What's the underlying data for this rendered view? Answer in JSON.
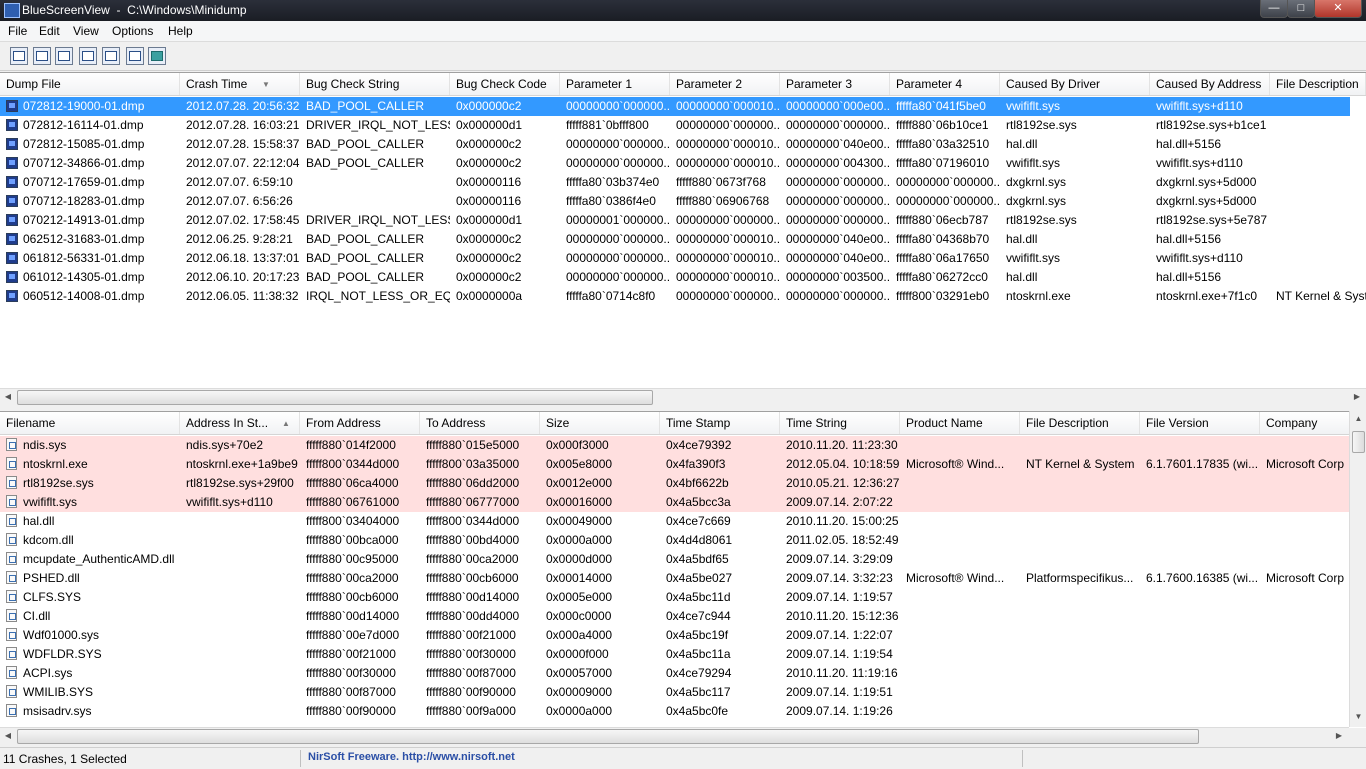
{
  "window": {
    "title": "BlueScreenView  -  C:\\Windows\\Minidump"
  },
  "menu": [
    "File",
    "Edit",
    "View",
    "Options",
    "Help"
  ],
  "toolbar": [
    "save-html-report-icon",
    "save-icon",
    "refresh-icon",
    "copy-icon",
    "properties-icon",
    "find-icon",
    "exit-icon"
  ],
  "crash_list": {
    "columns": [
      "Dump File",
      "Crash Time",
      "Bug Check String",
      "Bug Check Code",
      "Parameter 1",
      "Parameter 2",
      "Parameter 3",
      "Parameter 4",
      "Caused By Driver",
      "Caused By Address",
      "File Description"
    ],
    "rows": [
      [
        "072812-19000-01.dmp",
        "2012.07.28. 20:56:32",
        "BAD_POOL_CALLER",
        "0x000000c2",
        "00000000`000000...",
        "00000000`000010...",
        "00000000`000e00...",
        "fffffa80`041f5be0",
        "vwififlt.sys",
        "vwififlt.sys+d110",
        ""
      ],
      [
        "072812-16114-01.dmp",
        "2012.07.28. 16:03:21",
        "DRIVER_IRQL_NOT_LESS...",
        "0x000000d1",
        "fffff881`0bfff800",
        "00000000`000000...",
        "00000000`000000...",
        "fffff880`06b10ce1",
        "rtl8192se.sys",
        "rtl8192se.sys+b1ce1",
        ""
      ],
      [
        "072812-15085-01.dmp",
        "2012.07.28. 15:58:37",
        "BAD_POOL_CALLER",
        "0x000000c2",
        "00000000`000000...",
        "00000000`000010...",
        "00000000`040e00...",
        "fffffa80`03a32510",
        "hal.dll",
        "hal.dll+5156",
        ""
      ],
      [
        "070712-34866-01.dmp",
        "2012.07.07. 22:12:04",
        "BAD_POOL_CALLER",
        "0x000000c2",
        "00000000`000000...",
        "00000000`000010...",
        "00000000`004300...",
        "fffffa80`07196010",
        "vwififlt.sys",
        "vwififlt.sys+d110",
        ""
      ],
      [
        "070712-17659-01.dmp",
        "2012.07.07. 6:59:10",
        "",
        "0x00000116",
        "fffffa80`03b374e0",
        "fffff880`0673f768",
        "00000000`000000...",
        "00000000`000000...",
        "dxgkrnl.sys",
        "dxgkrnl.sys+5d000",
        ""
      ],
      [
        "070712-18283-01.dmp",
        "2012.07.07. 6:56:26",
        "",
        "0x00000116",
        "fffffa80`0386f4e0",
        "fffff880`06906768",
        "00000000`000000...",
        "00000000`000000...",
        "dxgkrnl.sys",
        "dxgkrnl.sys+5d000",
        ""
      ],
      [
        "070212-14913-01.dmp",
        "2012.07.02. 17:58:45",
        "DRIVER_IRQL_NOT_LESS...",
        "0x000000d1",
        "00000001`000000...",
        "00000000`000000...",
        "00000000`000000...",
        "fffff880`06ecb787",
        "rtl8192se.sys",
        "rtl8192se.sys+5e787",
        ""
      ],
      [
        "062512-31683-01.dmp",
        "2012.06.25. 9:28:21",
        "BAD_POOL_CALLER",
        "0x000000c2",
        "00000000`000000...",
        "00000000`000010...",
        "00000000`040e00...",
        "fffffa80`04368b70",
        "hal.dll",
        "hal.dll+5156",
        ""
      ],
      [
        "061812-56331-01.dmp",
        "2012.06.18. 13:37:01",
        "BAD_POOL_CALLER",
        "0x000000c2",
        "00000000`000000...",
        "00000000`000010...",
        "00000000`040e00...",
        "fffffa80`06a17650",
        "vwififlt.sys",
        "vwififlt.sys+d110",
        ""
      ],
      [
        "061012-14305-01.dmp",
        "2012.06.10. 20:17:23",
        "BAD_POOL_CALLER",
        "0x000000c2",
        "00000000`000000...",
        "00000000`000010...",
        "00000000`003500...",
        "fffffa80`06272cc0",
        "hal.dll",
        "hal.dll+5156",
        ""
      ],
      [
        "060512-14008-01.dmp",
        "2012.06.05. 11:38:32",
        "IRQL_NOT_LESS_OR_EQ...",
        "0x0000000a",
        "fffffa80`0714c8f0",
        "00000000`000000...",
        "00000000`000000...",
        "fffff800`03291eb0",
        "ntoskrnl.exe",
        "ntoskrnl.exe+7f1c0",
        "NT Kernel & Syst"
      ]
    ]
  },
  "driver_list": {
    "columns": [
      "Filename",
      "Address In St...",
      "From Address",
      "To Address",
      "Size",
      "Time Stamp",
      "Time String",
      "Product Name",
      "File Description",
      "File Version",
      "Company"
    ],
    "rows": [
      [
        "ndis.sys",
        "ndis.sys+70e2",
        "fffff880`014f2000",
        "fffff880`015e5000",
        "0x000f3000",
        "0x4ce79392",
        "2010.11.20. 11:23:30",
        "",
        "",
        "",
        ""
      ],
      [
        "ntoskrnl.exe",
        "ntoskrnl.exe+1a9be9",
        "fffff800`0344d000",
        "fffff800`03a35000",
        "0x005e8000",
        "0x4fa390f3",
        "2012.05.04. 10:18:59",
        "Microsoft® Wind...",
        "NT Kernel & System",
        "6.1.7601.17835 (wi...",
        "Microsoft Corp"
      ],
      [
        "rtl8192se.sys",
        "rtl8192se.sys+29f00",
        "fffff880`06ca4000",
        "fffff880`06dd2000",
        "0x0012e000",
        "0x4bf6622b",
        "2010.05.21. 12:36:27",
        "",
        "",
        "",
        ""
      ],
      [
        "vwififlt.sys",
        "vwififlt.sys+d110",
        "fffff880`06761000",
        "fffff880`06777000",
        "0x00016000",
        "0x4a5bcc3a",
        "2009.07.14. 2:07:22",
        "",
        "",
        "",
        ""
      ],
      [
        "hal.dll",
        "",
        "fffff800`03404000",
        "fffff800`0344d000",
        "0x00049000",
        "0x4ce7c669",
        "2010.11.20. 15:00:25",
        "",
        "",
        "",
        ""
      ],
      [
        "kdcom.dll",
        "",
        "fffff880`00bca000",
        "fffff880`00bd4000",
        "0x0000a000",
        "0x4d4d8061",
        "2011.02.05. 18:52:49",
        "",
        "",
        "",
        ""
      ],
      [
        "mcupdate_AuthenticAMD.dll",
        "",
        "fffff880`00c95000",
        "fffff880`00ca2000",
        "0x0000d000",
        "0x4a5bdf65",
        "2009.07.14. 3:29:09",
        "",
        "",
        "",
        ""
      ],
      [
        "PSHED.dll",
        "",
        "fffff880`00ca2000",
        "fffff880`00cb6000",
        "0x00014000",
        "0x4a5be027",
        "2009.07.14. 3:32:23",
        "Microsoft® Wind...",
        "Platformspecifikus...",
        "6.1.7600.16385 (wi...",
        "Microsoft Corp"
      ],
      [
        "CLFS.SYS",
        "",
        "fffff880`00cb6000",
        "fffff880`00d14000",
        "0x0005e000",
        "0x4a5bc11d",
        "2009.07.14. 1:19:57",
        "",
        "",
        "",
        ""
      ],
      [
        "CI.dll",
        "",
        "fffff880`00d14000",
        "fffff880`00dd4000",
        "0x000c0000",
        "0x4ce7c944",
        "2010.11.20. 15:12:36",
        "",
        "",
        "",
        ""
      ],
      [
        "Wdf01000.sys",
        "",
        "fffff880`00e7d000",
        "fffff880`00f21000",
        "0x000a4000",
        "0x4a5bc19f",
        "2009.07.14. 1:22:07",
        "",
        "",
        "",
        ""
      ],
      [
        "WDFLDR.SYS",
        "",
        "fffff880`00f21000",
        "fffff880`00f30000",
        "0x0000f000",
        "0x4a5bc11a",
        "2009.07.14. 1:19:54",
        "",
        "",
        "",
        ""
      ],
      [
        "ACPI.sys",
        "",
        "fffff880`00f30000",
        "fffff880`00f87000",
        "0x00057000",
        "0x4ce79294",
        "2010.11.20. 11:19:16",
        "",
        "",
        "",
        ""
      ],
      [
        "WMILIB.SYS",
        "",
        "fffff880`00f87000",
        "fffff880`00f90000",
        "0x00009000",
        "0x4a5bc117",
        "2009.07.14. 1:19:51",
        "",
        "",
        "",
        ""
      ],
      [
        "msisadrv.sys",
        "",
        "fffff880`00f90000",
        "fffff880`00f9a000",
        "0x0000a000",
        "0x4a5bc0fe",
        "2009.07.14. 1:19:26",
        "",
        "",
        "",
        ""
      ]
    ]
  },
  "status": {
    "left": "11 Crashes, 1 Selected",
    "middle": "NirSoft Freeware.  http://www.nirsoft.net"
  }
}
